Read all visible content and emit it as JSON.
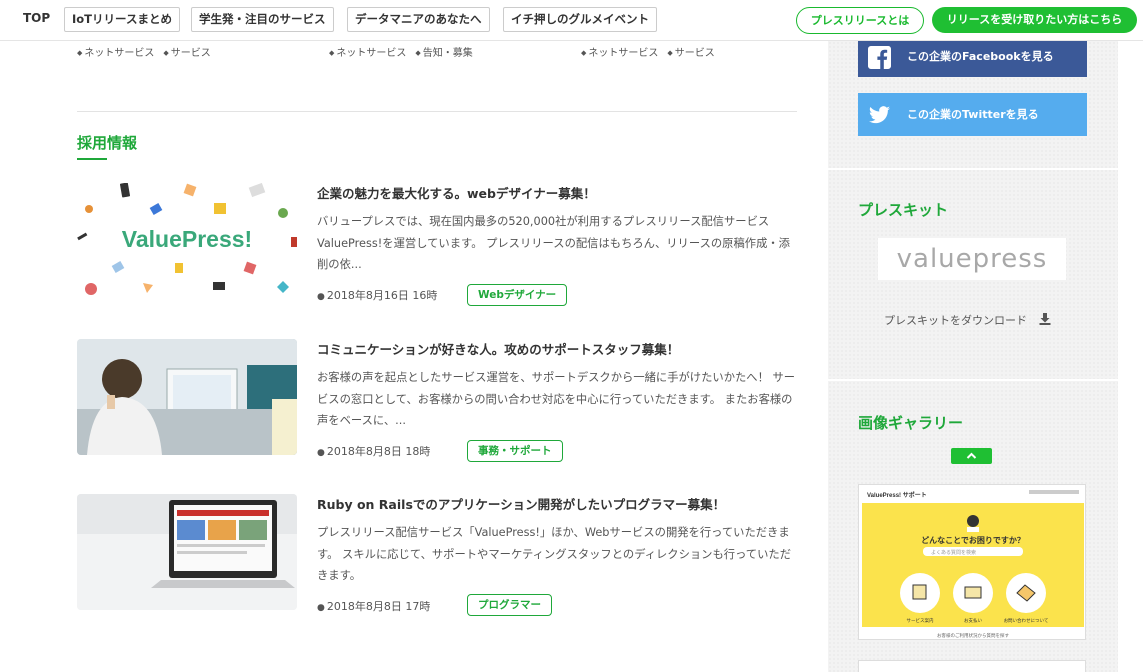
{
  "nav": {
    "top": "TOP",
    "tags": [
      "IoTリリースまとめ",
      "学生発・注目のサービス",
      "データマニアのあなたへ",
      "イチ押しのグルメイベント"
    ],
    "about_button": "プレスリリースとは",
    "subscribe_button": "リリースを受け取りたい方はこちら"
  },
  "tag_rows": [
    [
      "ネットサービス",
      "サービス"
    ],
    [
      "ネットサービス",
      "告知・募集"
    ],
    [
      "ネットサービス",
      "サービス"
    ]
  ],
  "recruit": {
    "title": "採用情報",
    "logo_text": "ValuePress!",
    "jobs": [
      {
        "title": "企業の魅力を最大化する。webデザイナー募集！",
        "desc": "バリュープレスでは、現在国内最多の520,000社が利用するプレスリリース配信サービスValuePress!を運営しています。 プレスリリースの配信はもちろん、リリースの原稿作成・添削の依...",
        "date": "2018年8月16日 16時",
        "badge": "Webデザイナー"
      },
      {
        "title": "コミュニケーションが好きな人。攻めのサポートスタッフ募集！",
        "desc": "お客様の声を起点としたサービス運営を、サポートデスクから一緒に手がけたいかたへ！ サービスの窓口として、お客様からの問い合わせ対応を中心に行っていただきます。 またお客様の声をベースに、...",
        "date": "2018年8月8日 18時",
        "badge": "事務・サポート"
      },
      {
        "title": "Ruby on Railsでのアプリケーション開発がしたいプログラマー募集！",
        "desc": "プレスリリース配信サービス「ValuePress!」ほか、Webサービスの開発を行っていただきます。 スキルに応じて、サポートやマーケティングスタッフとのディレクションも行っていただきます。",
        "date": "2018年8月8日 17時",
        "badge": "プログラマー"
      }
    ]
  },
  "sidebar": {
    "facebook_label": "この企業のFacebookを見る",
    "twitter_label": "この企業のTwitterを見る",
    "presskit_title": "プレスキット",
    "presskit_logo": "valuepress",
    "presskit_download": "プレスキットをダウンロード",
    "gallery_title": "画像ギャラリー",
    "gallery_image": {
      "brand": "ValuePress! サポート",
      "heading": "どんなことでお困りですか？",
      "search_placeholder": "よくある質問を検索",
      "items": [
        "サービス案内",
        "お支払い",
        "お問い合わせについて"
      ],
      "footer": "お客様のご利用状況から質問を探す"
    }
  },
  "colors": {
    "brand_green": "#1fbf33",
    "heading_green": "#1fa83a",
    "facebook": "#3b5998",
    "twitter": "#55acee"
  }
}
